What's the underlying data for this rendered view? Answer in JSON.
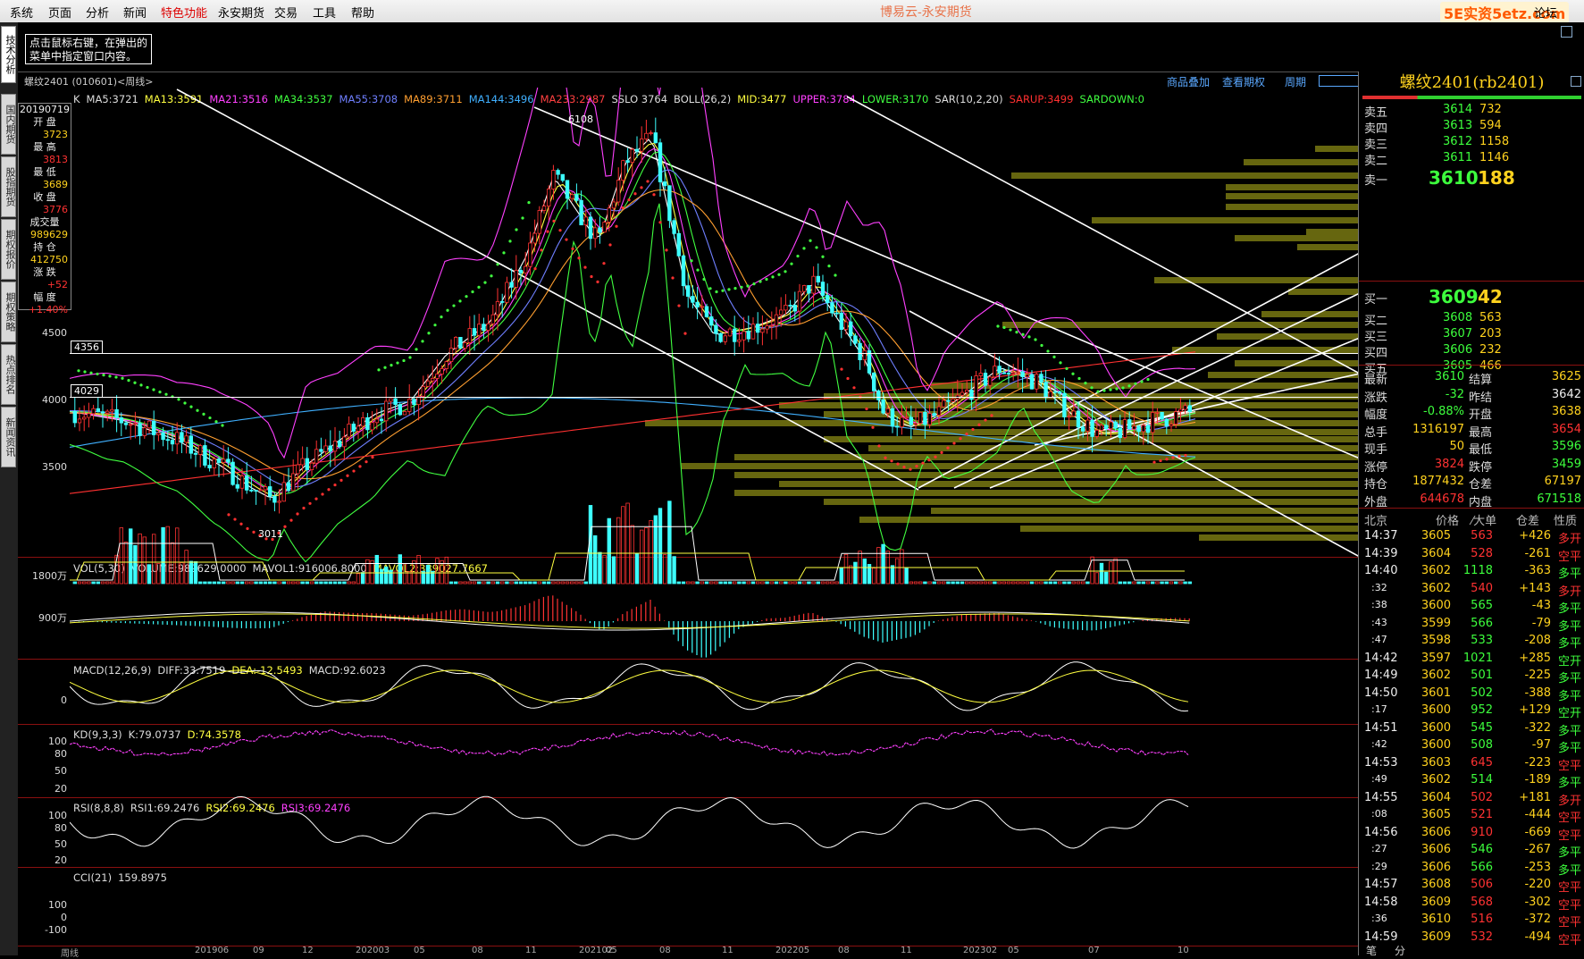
{
  "menu": [
    "系统",
    "页面",
    "分析",
    "新闻",
    "特色功能",
    "永安期货",
    "交易",
    "工具",
    "帮助"
  ],
  "window_title": "博易云-永安期货",
  "brand": "5E实资5etz.com",
  "brand_suffix": "论坛",
  "hint": "点击鼠标右键，在弹出的菜单中指定窗口内容。",
  "left_tabs": [
    "技术分析",
    "国内期货",
    "股指期货",
    "期权报价",
    "期权策略",
    "热点排名",
    "新闻资讯"
  ],
  "chart_header": {
    "title": "螺纹2401 (010601)<周线>",
    "links": [
      "商品叠加",
      "查看期权",
      "周期"
    ]
  },
  "ma_line": [
    {
      "t": "K",
      "c": "#dddddd"
    },
    {
      "t": "MA5:3721",
      "c": "#dddddd"
    },
    {
      "t": "MA13:3591",
      "c": "#ffff40"
    },
    {
      "t": "MA21:3516",
      "c": "#ff40ff"
    },
    {
      "t": "MA34:3537",
      "c": "#40ff40"
    },
    {
      "t": "MA55:3708",
      "c": "#6f7fff"
    },
    {
      "t": "MA89:3711",
      "c": "#ff9f30"
    },
    {
      "t": "MA144:3496",
      "c": "#40b0ff"
    },
    {
      "t": "MA233:2987",
      "c": "#ff4040"
    },
    {
      "t": "SSLO 3764",
      "c": "#dddddd"
    },
    {
      "t": "BOLL(26,2)",
      "c": "#dddddd"
    },
    {
      "t": "MID:3477",
      "c": "#ffff40"
    },
    {
      "t": "UPPER:3784",
      "c": "#ff40ff"
    },
    {
      "t": "LOWER:3170",
      "c": "#40ff40"
    },
    {
      "t": "SAR(10,2,20)",
      "c": "#dddddd"
    },
    {
      "t": "SARUP:3499",
      "c": "#ff3030"
    },
    {
      "t": "SARDOWN:0",
      "c": "#40ff40"
    }
  ],
  "info": {
    "date": "20190719",
    "open_label": "开 盘",
    "open": "3723",
    "high_label": "最 高",
    "high": "3813",
    "low_label": "最 低",
    "low": "3689",
    "close_label": "收 盘",
    "close": "3776",
    "vol_label": "成交量",
    "vol": "989629",
    "oi_label": "持 仓",
    "oi": "412750",
    "chg_label": "涨 跌",
    "chg": "+52",
    "pct_label": "幅 度",
    "pct": "+1.40%"
  },
  "price_axis": [
    "4500",
    "4000",
    "3500"
  ],
  "channel_lines": [
    {
      "label": "4356"
    },
    {
      "label": "4029"
    }
  ],
  "annotations": {
    "high": "6108",
    "low": "3011"
  },
  "vol_indicator": [
    {
      "t": "VOL(5,30)",
      "c": "#dddddd"
    },
    {
      "t": "VOLUME:989629.0000",
      "c": "#dddddd"
    },
    {
      "t": "MAVOL1:916006.8000",
      "c": "#dddddd"
    },
    {
      "t": "MAVOL2:339027.7667",
      "c": "#ffff40"
    }
  ],
  "vol_axis": [
    "1800万",
    "900万"
  ],
  "macd_indicator": [
    {
      "t": "MACD(12,26,9)",
      "c": "#dddddd"
    },
    {
      "t": "DIFF:33.7519",
      "c": "#dddddd"
    },
    {
      "t": "DEA:-12.5493",
      "c": "#ffff40"
    },
    {
      "t": "MACD:92.6023",
      "c": "#dddddd"
    }
  ],
  "macd_axis": [
    "0"
  ],
  "kd_indicator": [
    {
      "t": "KD(9,3,3)",
      "c": "#dddddd"
    },
    {
      "t": "K:79.0737",
      "c": "#dddddd"
    },
    {
      "t": "D:74.3578",
      "c": "#ffff40"
    }
  ],
  "kd_axis": [
    "100",
    "80",
    "50",
    "20"
  ],
  "rsi_indicator": [
    {
      "t": "RSI(8,8,8)",
      "c": "#dddddd"
    },
    {
      "t": "RSI1:69.2476",
      "c": "#dddddd"
    },
    {
      "t": "RSI2:69.2476",
      "c": "#ffff40"
    },
    {
      "t": "RSI3:69.2476",
      "c": "#ff40ff"
    }
  ],
  "rsi_axis": [
    "100",
    "80",
    "50",
    "20"
  ],
  "cci_indicator": [
    {
      "t": "CCI(21)",
      "c": "#dddddd"
    },
    {
      "t": "159.8975",
      "c": "#dddddd"
    }
  ],
  "cci_axis": [
    "100",
    "0",
    "-100"
  ],
  "x_axis": [
    "周线",
    "201906",
    "09",
    "12",
    "202003",
    "05",
    "08",
    "11",
    "202102",
    "05",
    "08",
    "11",
    "202205",
    "08",
    "11",
    "202302",
    "05",
    "07",
    "10"
  ],
  "quote": {
    "title": "螺纹2401(rb2401)",
    "asks": [
      {
        "l": "卖五",
        "p": "3614",
        "v": "732"
      },
      {
        "l": "卖四",
        "p": "3613",
        "v": "594"
      },
      {
        "l": "卖三",
        "p": "3612",
        "v": "1158"
      },
      {
        "l": "卖二",
        "p": "3611",
        "v": "1146"
      },
      {
        "l": "卖一",
        "p": "3610",
        "v": "188"
      }
    ],
    "bids": [
      {
        "l": "买一",
        "p": "3609",
        "v": "42"
      },
      {
        "l": "买二",
        "p": "3608",
        "v": "563"
      },
      {
        "l": "买三",
        "p": "3607",
        "v": "203"
      },
      {
        "l": "买四",
        "p": "3606",
        "v": "232"
      },
      {
        "l": "买五",
        "p": "3605",
        "v": "466"
      }
    ],
    "stats": [
      {
        "l1": "最新",
        "v1": "3610",
        "c1": "grn",
        "l2": "结算",
        "v2": "3625",
        "c2": "yel"
      },
      {
        "l1": "涨跌",
        "v1": "-32",
        "c1": "grn",
        "l2": "昨结",
        "v2": "3642",
        "c2": "wht"
      },
      {
        "l1": "幅度",
        "v1": "-0.88%",
        "c1": "grn",
        "l2": "开盘",
        "v2": "3638",
        "c2": "yel"
      },
      {
        "l1": "总手",
        "v1": "1316197",
        "c1": "yel",
        "l2": "最高",
        "v2": "3654",
        "c2": "red"
      },
      {
        "l1": "现手",
        "v1": "50",
        "c1": "yel",
        "l2": "最低",
        "v2": "3596",
        "c2": "grn"
      },
      {
        "l1": "涨停",
        "v1": "3824",
        "c1": "red",
        "l2": "跌停",
        "v2": "3459",
        "c2": "grn"
      },
      {
        "l1": "持仓",
        "v1": "1877432",
        "c1": "yel",
        "l2": "仓差",
        "v2": "67197",
        "c2": "yel"
      },
      {
        "l1": "外盘",
        "v1": "644678",
        "c1": "red",
        "l2": "内盘",
        "v2": "671518",
        "c2": "grn"
      }
    ],
    "tick_header": [
      "北京",
      "价格",
      "⁄大单",
      "仓差",
      "性质"
    ],
    "ticks": [
      {
        "t": "14:37",
        "p": "3605",
        "v": "563",
        "d": "+426",
        "n": "多开",
        "c": "red"
      },
      {
        "t": "14:39",
        "p": "3604",
        "v": "528",
        "d": "-261",
        "n": "空平",
        "c": "red"
      },
      {
        "t": "14:40",
        "p": "3602",
        "v": "1118",
        "d": "-363",
        "n": "多平",
        "c": "grn"
      },
      {
        "t": ":32",
        "p": "3602",
        "v": "540",
        "d": "+143",
        "n": "多开",
        "c": "red"
      },
      {
        "t": ":38",
        "p": "3600",
        "v": "565",
        "d": "-43",
        "n": "多平",
        "c": "grn"
      },
      {
        "t": ":43",
        "p": "3599",
        "v": "566",
        "d": "-79",
        "n": "多平",
        "c": "grn"
      },
      {
        "t": ":47",
        "p": "3598",
        "v": "533",
        "d": "-208",
        "n": "多平",
        "c": "grn"
      },
      {
        "t": "14:42",
        "p": "3597",
        "v": "1021",
        "d": "+285",
        "n": "空开",
        "c": "grn"
      },
      {
        "t": "14:49",
        "p": "3602",
        "v": "501",
        "d": "-225",
        "n": "多平",
        "c": "grn"
      },
      {
        "t": "14:50",
        "p": "3601",
        "v": "502",
        "d": "-388",
        "n": "多平",
        "c": "grn"
      },
      {
        "t": ":17",
        "p": "3600",
        "v": "952",
        "d": "+129",
        "n": "空开",
        "c": "grn"
      },
      {
        "t": "14:51",
        "p": "3600",
        "v": "545",
        "d": "-322",
        "n": "多平",
        "c": "grn"
      },
      {
        "t": ":42",
        "p": "3600",
        "v": "508",
        "d": "-97",
        "n": "多平",
        "c": "grn"
      },
      {
        "t": "14:53",
        "p": "3603",
        "v": "645",
        "d": "-223",
        "n": "空平",
        "c": "red"
      },
      {
        "t": ":49",
        "p": "3602",
        "v": "514",
        "d": "-189",
        "n": "多平",
        "c": "grn"
      },
      {
        "t": "14:55",
        "p": "3604",
        "v": "502",
        "d": "+181",
        "n": "多开",
        "c": "red"
      },
      {
        "t": ":08",
        "p": "3605",
        "v": "521",
        "d": "-444",
        "n": "空平",
        "c": "red"
      },
      {
        "t": "14:56",
        "p": "3606",
        "v": "910",
        "d": "-669",
        "n": "空平",
        "c": "red"
      },
      {
        "t": ":27",
        "p": "3606",
        "v": "546",
        "d": "-267",
        "n": "多平",
        "c": "grn"
      },
      {
        "t": ":29",
        "p": "3606",
        "v": "566",
        "d": "-253",
        "n": "多平",
        "c": "grn"
      },
      {
        "t": "14:57",
        "p": "3608",
        "v": "506",
        "d": "-220",
        "n": "空平",
        "c": "red"
      },
      {
        "t": "14:58",
        "p": "3609",
        "v": "568",
        "d": "-302",
        "n": "空平",
        "c": "red"
      },
      {
        "t": ":36",
        "p": "3610",
        "v": "516",
        "d": "-372",
        "n": "空平",
        "c": "red"
      },
      {
        "t": "14:59",
        "p": "3609",
        "v": "532",
        "d": "-494",
        "n": "空平",
        "c": "red"
      }
    ],
    "bottom_tabs": [
      "笔",
      "分"
    ]
  },
  "colors": {
    "up": "#ff3232",
    "down": "#3dffff",
    "ma5": "#ffffff",
    "ma13": "#ffff40",
    "ma21": "#ff40ff",
    "ma34": "#40ff40",
    "ma55": "#6f7fff",
    "ma89": "#ff9f30",
    "ma144": "#40b0ff",
    "ma233": "#ff3030",
    "volprofile": "#6b6b10"
  }
}
